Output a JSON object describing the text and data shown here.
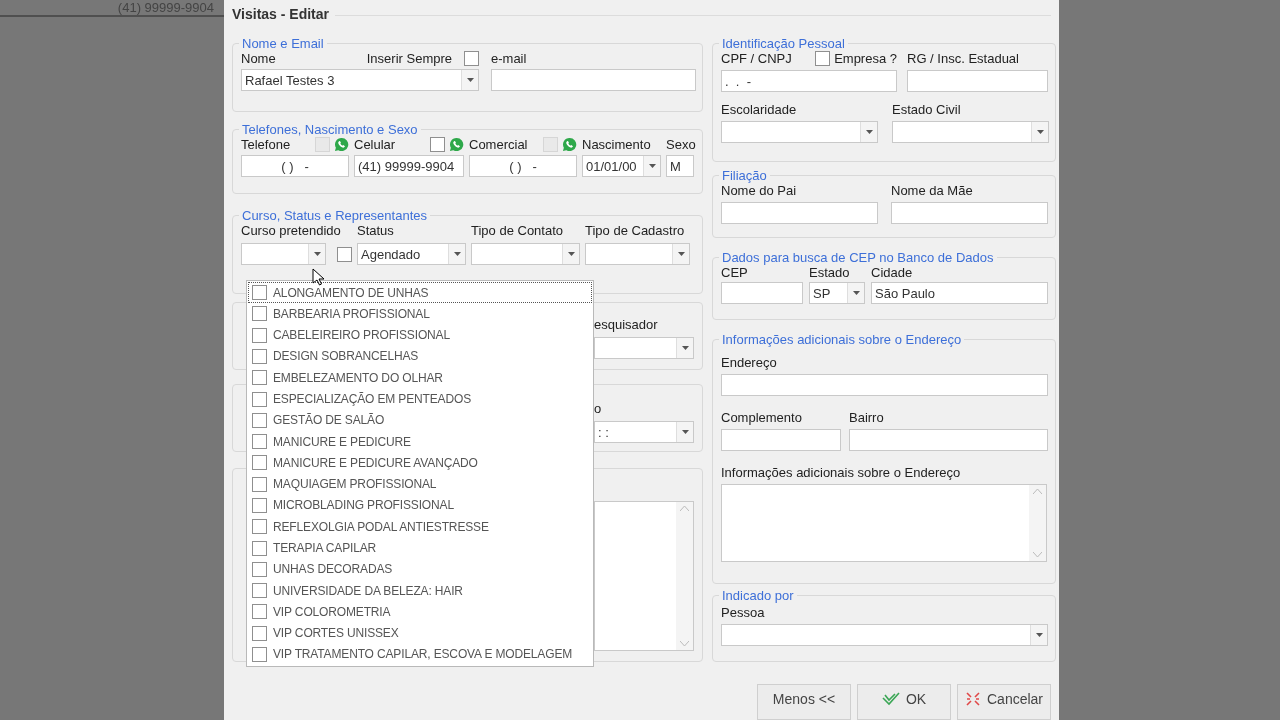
{
  "background": {
    "phone_text": "(41) 99999-9904"
  },
  "dialog": {
    "title": "Visitas - Editar"
  },
  "nome_email": {
    "title": "Nome e Email",
    "nome_label": "Nome",
    "inserir_sempre": {
      "label": "Inserir Sempre",
      "checked": false
    },
    "nome_value": "Rafael Testes 3",
    "email_label": "e-mail"
  },
  "telefones": {
    "title": "Telefones, Nascimento e Sexo",
    "phones": [
      {
        "label": "Telefone",
        "value": "( )   -",
        "whatsapp": {
          "checked": false,
          "disabled": true
        }
      },
      {
        "label": "Celular",
        "value": "(41) 99999-9904",
        "whatsapp": {
          "checked": false,
          "disabled": false
        }
      },
      {
        "label": "Comercial",
        "value": "( )   -",
        "whatsapp": {
          "checked": false,
          "disabled": true
        }
      }
    ],
    "nascimento": {
      "label": "Nascimento",
      "value": "01/01/00"
    },
    "sexo": {
      "label": "Sexo",
      "value": "M"
    }
  },
  "curso": {
    "title": "Curso, Status e Representantes",
    "curso_label": "Curso pretendido",
    "curso_checked": false,
    "fields": [
      {
        "label": "Status",
        "value": "Agendado"
      },
      {
        "label": "Tipo de Contato"
      },
      {
        "label": "Tipo de Cadastro"
      }
    ]
  },
  "dropdown": {
    "items": [
      {
        "label": "ALONGAMENTO DE UNHAS",
        "checked": false,
        "selected": true
      },
      {
        "label": "BARBEARIA PROFISSIONAL",
        "checked": false,
        "selected": false
      },
      {
        "label": "CABELEIREIRO PROFISSIONAL",
        "checked": false,
        "selected": false
      },
      {
        "label": "DESIGN SOBRANCELHAS",
        "checked": false,
        "selected": false
      },
      {
        "label": "EMBELEZAMENTO DO OLHAR",
        "checked": false,
        "selected": false
      },
      {
        "label": "ESPECIALIZAÇÃO EM PENTEADOS",
        "checked": false,
        "selected": false
      },
      {
        "label": "GESTÃO DE SALÃO",
        "checked": false,
        "selected": false
      },
      {
        "label": "MANICURE E PEDICURE",
        "checked": false,
        "selected": false
      },
      {
        "label": "MANICURE E PEDICURE AVANÇADO",
        "checked": false,
        "selected": false
      },
      {
        "label": "MAQUIAGEM PROFISSIONAL",
        "checked": false,
        "selected": false
      },
      {
        "label": "MICROBLADING PROFISSIONAL",
        "checked": false,
        "selected": false
      },
      {
        "label": "REFLEXOLGIA PODAL ANTIESTRESSE",
        "checked": false,
        "selected": false
      },
      {
        "label": "TERAPIA CAPILAR",
        "checked": false,
        "selected": false
      },
      {
        "label": "UNHAS DECORADAS",
        "checked": false,
        "selected": false
      },
      {
        "label": "UNIVERSIDADE DA BELEZA: HAIR",
        "checked": false,
        "selected": false
      },
      {
        "label": "VIP COLOROMETRIA",
        "checked": false,
        "selected": false
      },
      {
        "label": "VIP CORTES UNISSEX",
        "checked": false,
        "selected": false
      },
      {
        "label": "VIP TRATAMENTO CAPILAR, ESCOVA E MODELAGEM",
        "checked": false,
        "selected": false
      }
    ]
  },
  "hidden_groups": [
    {
      "kind": "combo",
      "label": "esquisador"
    },
    {
      "kind": "combo",
      "label": "o",
      "value": ": :"
    },
    {
      "kind": "textarea"
    }
  ],
  "identificacao": {
    "title": "Identificação Pessoal",
    "cpf_label": "CPF / CNPJ",
    "cpf_value": ".  .  -",
    "empresa": {
      "label": "Empresa ?",
      "checked": false
    },
    "rg_label": "RG / Insc. Estadual",
    "escolaridade_label": "Escolaridade",
    "estado_civil_label": "Estado Civil"
  },
  "filiacao": {
    "title": "Filiação",
    "pai_label": "Nome do Pai",
    "mae_label": "Nome da Mãe"
  },
  "cep": {
    "title": "Dados para busca de CEP no Banco de Dados",
    "cep_label": "CEP",
    "estado_label": "Estado",
    "estado_value": "SP",
    "cidade_label": "Cidade",
    "cidade_value": "São Paulo"
  },
  "endereco": {
    "title": "Informações adicionais sobre o Endereço",
    "endereco_label": "Endereço",
    "complemento_label": "Complemento",
    "bairro_label": "Bairro",
    "info_label": "Informações adicionais sobre o Endereço"
  },
  "indicado": {
    "title": "Indicado por",
    "pessoa_label": "Pessoa"
  },
  "buttons": [
    {
      "label": "Menos <<",
      "kind": "plain"
    },
    {
      "label": "OK",
      "kind": "ok"
    },
    {
      "label": "Cancelar",
      "kind": "cancel"
    }
  ]
}
